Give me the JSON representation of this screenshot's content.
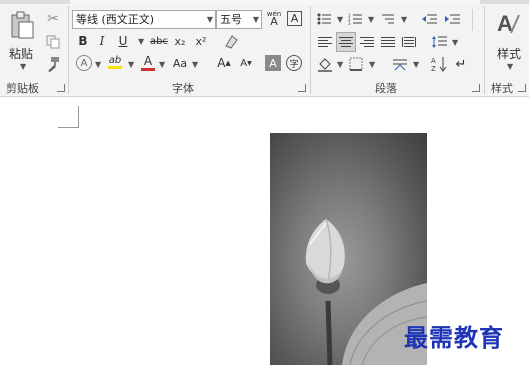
{
  "clipboard": {
    "paste_label": "粘贴",
    "group_label": "剪贴板"
  },
  "font": {
    "font_name": "等线 (西文正文)",
    "font_size": "五号",
    "bold": "B",
    "italic": "I",
    "underline": "U",
    "strikethrough": "abc",
    "subscript": "x₂",
    "superscript": "x²",
    "change_case": "Aa",
    "grow": "A",
    "shrink": "A",
    "char_shading": "A",
    "enclose": "字",
    "phonetic": "wén",
    "char_border": "A",
    "font_color": "A",
    "text_effect": "A",
    "group_label": "字体"
  },
  "paragraph": {
    "group_label": "段落"
  },
  "styles": {
    "label": "样式",
    "group_label": "样式"
  },
  "watermark": {
    "text": "最需教育"
  },
  "colors": {
    "font_color_bar": "#d0302a",
    "highlight_bar": "#f5e300",
    "watermark": "#1f35b8"
  }
}
